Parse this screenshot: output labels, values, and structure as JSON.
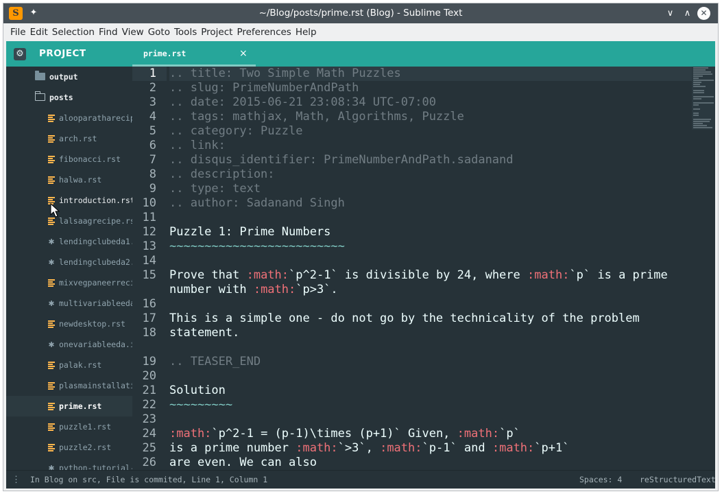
{
  "window": {
    "title": "~/Blog/posts/prime.rst (Blog) - Sublime Text",
    "app_icon": "sublime-text-icon",
    "controls": [
      "chevron-down-icon",
      "chevron-up-icon",
      "close-icon"
    ]
  },
  "menu": [
    "File",
    "Edit",
    "Selection",
    "Find",
    "View",
    "Goto",
    "Tools",
    "Project",
    "Preferences",
    "Help"
  ],
  "sidebar": {
    "title": "PROJECT",
    "items": [
      {
        "label": "output",
        "type": "folder"
      },
      {
        "label": "posts",
        "type": "folder-open"
      },
      {
        "label": "alooparatharecip",
        "type": "file"
      },
      {
        "label": "arch.rst",
        "type": "file"
      },
      {
        "label": "fibonacci.rst",
        "type": "file"
      },
      {
        "label": "halwa.rst",
        "type": "file"
      },
      {
        "label": "introduction.rst",
        "type": "file"
      },
      {
        "label": "lalsaagrecipe.rs",
        "type": "file"
      },
      {
        "label": "lendingclubeda1.",
        "type": "star"
      },
      {
        "label": "lendingclubeda2.",
        "type": "star"
      },
      {
        "label": "mixvegpaneerreci",
        "type": "file"
      },
      {
        "label": "multivariableeda",
        "type": "star"
      },
      {
        "label": "newdesktop.rst",
        "type": "file"
      },
      {
        "label": "onevariableeda.i",
        "type": "star"
      },
      {
        "label": "palak.rst",
        "type": "file"
      },
      {
        "label": "plasmainstallati",
        "type": "file"
      },
      {
        "label": "prime.rst",
        "type": "file"
      },
      {
        "label": "puzzle1.rst",
        "type": "file"
      },
      {
        "label": "puzzle2.rst",
        "type": "file"
      },
      {
        "label": "python-tutorial-",
        "type": "star"
      }
    ]
  },
  "tab": {
    "label": "prime.rst",
    "close": "×"
  },
  "editor": {
    "line_numbers": [
      "1",
      "2",
      "3",
      "4",
      "5",
      "6",
      "7",
      "8",
      "9",
      "10",
      "11",
      "12",
      "13",
      "14",
      "15",
      "",
      "16",
      "17",
      "18",
      "",
      "19",
      "20",
      "21",
      "22",
      "23",
      "24",
      "25",
      "26",
      "27"
    ],
    "lines": [
      {
        "segments": [
          {
            "t": ".. title: Two Simple Math Puzzles",
            "s": "c"
          }
        ]
      },
      {
        "segments": [
          {
            "t": ".. slug: PrimeNumberAndPath",
            "s": "c"
          }
        ]
      },
      {
        "segments": [
          {
            "t": ".. date: 2015-06-21 23:08:34 UTC-07:00",
            "s": "c"
          }
        ]
      },
      {
        "segments": [
          {
            "t": ".. tags: mathjax, Math, Algorithms, Puzzle",
            "s": "c"
          }
        ]
      },
      {
        "segments": [
          {
            "t": ".. category: Puzzle",
            "s": "c"
          }
        ]
      },
      {
        "segments": [
          {
            "t": ".. link:",
            "s": "c"
          }
        ]
      },
      {
        "segments": [
          {
            "t": ".. disqus_identifier: PrimeNumberAndPath.sadanand",
            "s": "c"
          }
        ]
      },
      {
        "segments": [
          {
            "t": ".. description:",
            "s": "c"
          }
        ]
      },
      {
        "segments": [
          {
            "t": ".. type: text",
            "s": "c"
          }
        ]
      },
      {
        "segments": [
          {
            "t": ".. author: Sadanand Singh",
            "s": "c"
          }
        ]
      },
      {
        "segments": [
          {
            "t": "",
            "s": ""
          }
        ]
      },
      {
        "segments": [
          {
            "t": "Puzzle 1: Prime Numbers",
            "s": ""
          }
        ]
      },
      {
        "segments": [
          {
            "t": "~~~~~~~~~~~~~~~~~~~~~~~~~",
            "s": "under"
          }
        ]
      },
      {
        "segments": [
          {
            "t": "",
            "s": ""
          }
        ]
      },
      {
        "segments": [
          {
            "t": "Prove that ",
            "s": ""
          },
          {
            "t": ":math:",
            "s": "kw"
          },
          {
            "t": "`p^2-1` is divisible by 24, where ",
            "s": ""
          },
          {
            "t": ":math:",
            "s": "kw"
          },
          {
            "t": "`p` is a prime",
            "s": ""
          }
        ]
      },
      {
        "segments": [
          {
            "t": "number with ",
            "s": ""
          },
          {
            "t": ":math:",
            "s": "kw"
          },
          {
            "t": "`p>3`.",
            "s": ""
          }
        ]
      },
      {
        "segments": [
          {
            "t": "",
            "s": ""
          }
        ]
      },
      {
        "segments": [
          {
            "t": "This is a simple one - do not go by the technicality of the problem",
            "s": ""
          }
        ]
      },
      {
        "segments": [
          {
            "t": "statement.",
            "s": ""
          }
        ]
      },
      {
        "segments": [
          {
            "t": "",
            "s": ""
          }
        ]
      },
      {
        "segments": [
          {
            "t": ".. TEASER_END",
            "s": "c"
          }
        ]
      },
      {
        "segments": [
          {
            "t": "",
            "s": ""
          }
        ]
      },
      {
        "segments": [
          {
            "t": "Solution",
            "s": ""
          }
        ]
      },
      {
        "segments": [
          {
            "t": "~~~~~~~~~",
            "s": "under"
          }
        ]
      },
      {
        "segments": [
          {
            "t": "",
            "s": ""
          }
        ]
      },
      {
        "segments": [
          {
            "t": ":math:",
            "s": "kw"
          },
          {
            "t": "`p^2-1 = (p-1)\\times (p+1)` Given, ",
            "s": ""
          },
          {
            "t": ":math:",
            "s": "kw"
          },
          {
            "t": "`p`",
            "s": ""
          }
        ]
      },
      {
        "segments": [
          {
            "t": "is a prime number ",
            "s": ""
          },
          {
            "t": ":math:",
            "s": "kw"
          },
          {
            "t": "`>3`, ",
            "s": ""
          },
          {
            "t": ":math:",
            "s": "kw"
          },
          {
            "t": "`p-1` and ",
            "s": ""
          },
          {
            "t": ":math:",
            "s": "kw"
          },
          {
            "t": "`p+1`",
            "s": ""
          }
        ]
      },
      {
        "segments": [
          {
            "t": "are even. We can also",
            "s": ""
          }
        ]
      }
    ]
  },
  "status": {
    "menu_icon": "⋮",
    "text": "In Blog on src, File is commited, Line 1, Column 1",
    "spaces": "Spaces: 4",
    "syntax": "reStructuredText"
  }
}
